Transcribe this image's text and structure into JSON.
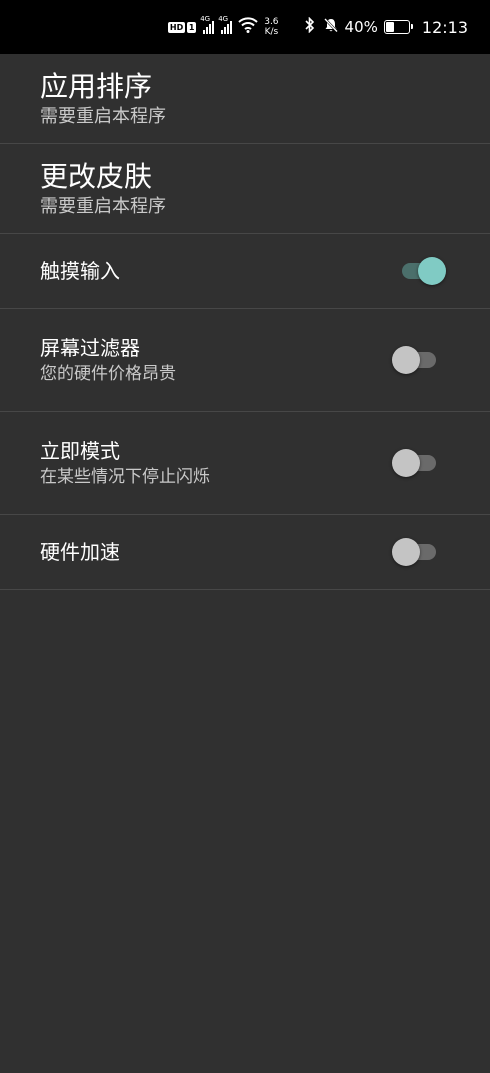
{
  "status_bar": {
    "hd_label": "HD",
    "sim_label": "1",
    "network1": "4G",
    "network2": "4G",
    "speed_value": "3.6",
    "speed_unit": "K/s",
    "battery_percent": "40%",
    "battery_level": 0.4,
    "time": "12:13"
  },
  "settings": [
    {
      "title": "应用排序",
      "subtitle": "需要重启本程序"
    },
    {
      "title": "更改皮肤",
      "subtitle": "需要重启本程序"
    },
    {
      "title": "触摸输入",
      "enabled": true
    },
    {
      "title": "屏幕过滤器",
      "subtitle": "您的硬件价格昂贵",
      "enabled": false
    },
    {
      "title": "立即模式",
      "subtitle": "在某些情况下停止闪烁",
      "enabled": false
    },
    {
      "title": "硬件加速",
      "enabled": false
    }
  ],
  "colors": {
    "background": "#303030",
    "divider": "#474747",
    "switch_on_thumb": "#80cbc4",
    "switch_on_track": "#4b6f6b",
    "switch_off_thumb": "#c4c4c4",
    "switch_off_track": "#6a6a6a"
  }
}
